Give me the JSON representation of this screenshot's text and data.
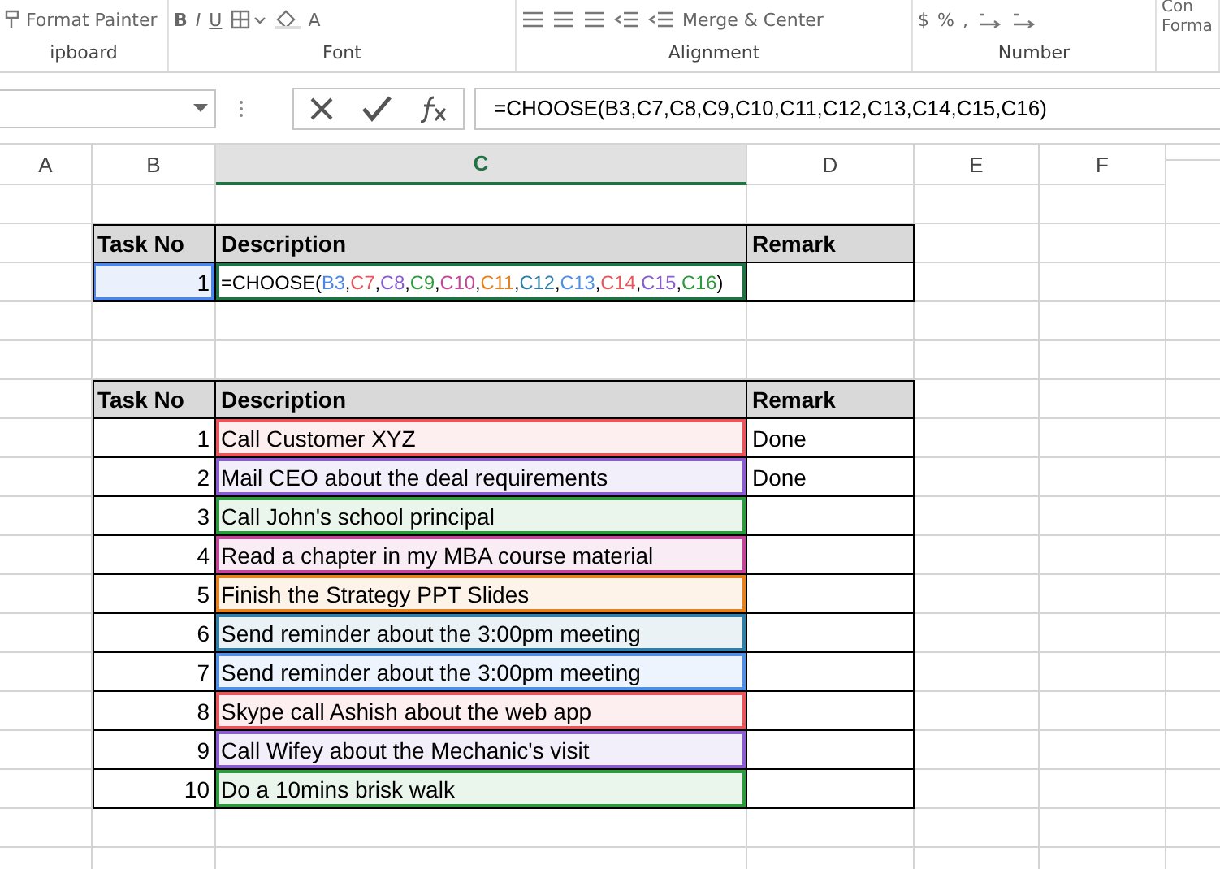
{
  "ribbon": {
    "groups": [
      {
        "label": "ipboard",
        "items": [
          {
            "kind": "brush",
            "text": "Format Painter"
          }
        ]
      },
      {
        "label": "Font",
        "items": [
          {
            "kind": "bold",
            "text": "B"
          },
          {
            "kind": "italic",
            "text": "I"
          },
          {
            "kind": "underline",
            "text": "U"
          },
          {
            "kind": "borders"
          },
          {
            "kind": "fill"
          },
          {
            "kind": "fontcolor",
            "text": "A"
          }
        ]
      },
      {
        "label": "Alignment",
        "items": [
          {
            "kind": "align"
          },
          {
            "kind": "align"
          },
          {
            "kind": "align"
          },
          {
            "kind": "indent"
          },
          {
            "kind": "indent"
          },
          {
            "kind": "merge",
            "text": "Merge & Center"
          }
        ]
      },
      {
        "label": "Number",
        "items": [
          {
            "kind": "plain",
            "text": "$"
          },
          {
            "kind": "plain",
            "text": "%"
          },
          {
            "kind": "plain",
            "text": ","
          },
          {
            "kind": "decimal"
          },
          {
            "kind": "decimal"
          }
        ]
      },
      {
        "items": [
          {
            "kind": "stack",
            "text": "Con",
            "text2": "Forma"
          }
        ]
      }
    ]
  },
  "formula_bar": {
    "formula": "=CHOOSE(B3,C7,C8,C9,C10,C11,C12,C13,C14,C15,C16)"
  },
  "columns": [
    {
      "label": "A",
      "selected": false
    },
    {
      "label": "B",
      "selected": false
    },
    {
      "label": "C",
      "selected": true
    },
    {
      "label": "D",
      "selected": false
    },
    {
      "label": "E",
      "selected": false
    },
    {
      "label": "F",
      "selected": false
    }
  ],
  "table1": {
    "columns": [
      "Task No",
      "Description",
      "Remark"
    ],
    "task_no": "1",
    "prefix": "=CHOOSE(",
    "separator": ",",
    "suffix": ")",
    "refs": [
      {
        "text": "B3",
        "color": "#4f86e6"
      },
      {
        "text": "C7",
        "color": "#e8555a"
      },
      {
        "text": "C8",
        "color": "#8a5ccf"
      },
      {
        "text": "C9",
        "color": "#2e9a3e"
      },
      {
        "text": "C10",
        "color": "#c4449a"
      },
      {
        "text": "C11",
        "color": "#e6821e"
      },
      {
        "text": "C12",
        "color": "#2f7fa8"
      },
      {
        "text": "C13",
        "color": "#4f8fe6"
      },
      {
        "text": "C14",
        "color": "#e8555a"
      },
      {
        "text": "C15",
        "color": "#8a5ccf"
      },
      {
        "text": "C16",
        "color": "#2e9a3e"
      }
    ]
  },
  "table2": {
    "columns": [
      "Task No",
      "Description",
      "Remark"
    ],
    "rows": [
      {
        "task_no": "1",
        "description": "Call Customer XYZ",
        "remark": "Done",
        "color": "#e8555a"
      },
      {
        "task_no": "2",
        "description": "Mail CEO about the deal requirements",
        "remark": "Done",
        "color": "#8a5ccf"
      },
      {
        "task_no": "3",
        "description": "Call John's school principal",
        "color": "#2e9a3e"
      },
      {
        "task_no": "4",
        "description": "Read a chapter in my MBA course material",
        "color": "#c4449a"
      },
      {
        "task_no": "5",
        "description": "Finish the Strategy PPT Slides",
        "color": "#e6821e"
      },
      {
        "task_no": "6",
        "description": "Send reminder about the 3:00pm meeting",
        "color": "#2f7fa8"
      },
      {
        "task_no": "7",
        "description": "Send reminder about the 3:00pm meeting",
        "color": "#4f8fe6"
      },
      {
        "task_no": "8",
        "description": "Skype call Ashish about the web app",
        "color": "#e8555a"
      },
      {
        "task_no": "9",
        "description": "Call Wifey about the Mechanic's visit",
        "color": "#8a5ccf"
      },
      {
        "task_no": "10",
        "description": "Do a 10mins brisk walk",
        "color": "#2e9a3e"
      }
    ]
  }
}
